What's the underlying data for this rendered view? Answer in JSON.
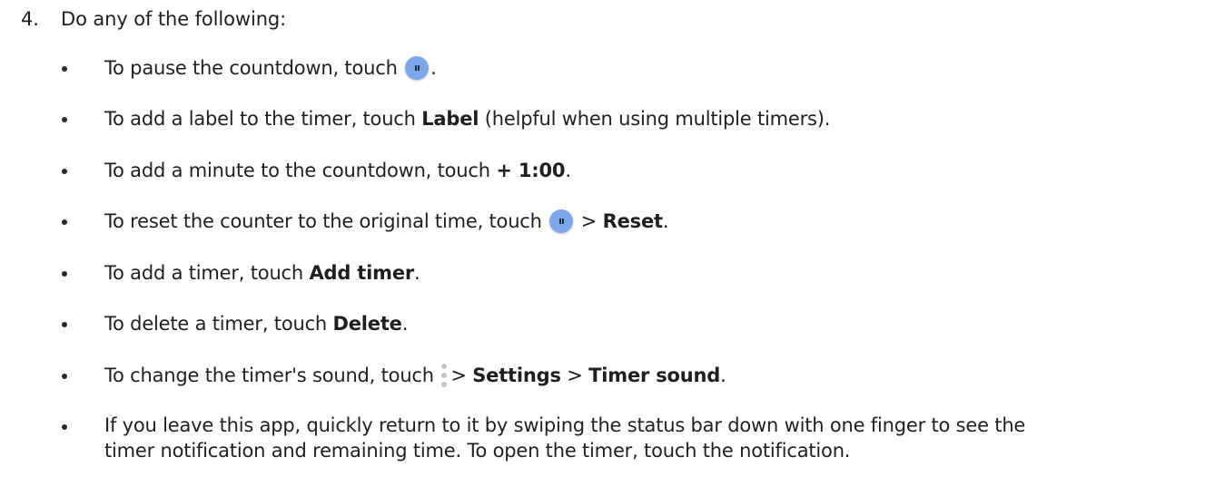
{
  "step": {
    "number": "4.",
    "text": "Do any of the following:"
  },
  "bullets": [
    {
      "pre": "To pause the countdown, touch",
      "icon": "pause-icon",
      "post": "."
    },
    {
      "pre": "To add a label to the timer, touch ",
      "bold": "Label",
      "post": " (helpful when using multiple timers)."
    },
    {
      "pre": "To add a minute to the countdown, touch ",
      "bold": "+ 1:00",
      "post": "."
    },
    {
      "pre": "To reset the counter to the original time, touch",
      "icon": "pause-icon",
      "mid": "> ",
      "bold": "Reset",
      "post": "."
    },
    {
      "pre": "To add a timer, touch ",
      "bold": "Add timer",
      "post": "."
    },
    {
      "pre": "To delete a timer, touch ",
      "bold": "Delete",
      "post": "."
    },
    {
      "pre": "To change the timer's sound, touch",
      "icon": "more-vert-icon",
      "mid": "> ",
      "bold": "Settings",
      "mid2": " > ",
      "bold2": "Timer sound",
      "post": "."
    },
    {
      "line1": "If you leave this app, quickly return to it by swiping the status bar down with one finger to see the",
      "line2": "timer notification and remaining time. To open the timer, touch the notification."
    }
  ],
  "colors": {
    "text": "#1f1f1f",
    "pause_button": "#7ea6ea",
    "menu_dots": "#c4c4c4"
  }
}
